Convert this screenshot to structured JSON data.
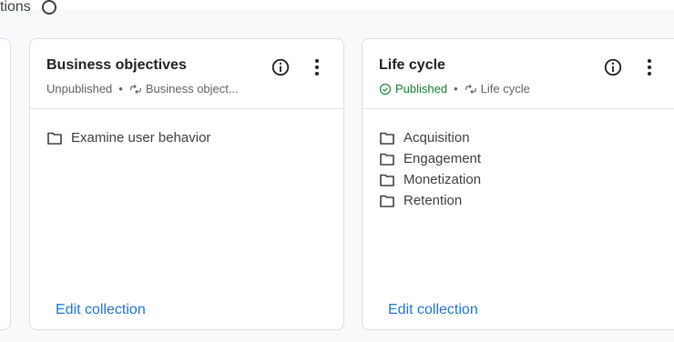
{
  "header_fragment": {
    "text": "tions"
  },
  "cards": [
    {
      "title": "Business objectives",
      "status": "Unpublished",
      "collection": "Business object...",
      "items": [
        "Examine user behavior"
      ],
      "edit_label": "Edit collection"
    },
    {
      "title": "Life cycle",
      "status": "Published",
      "collection": "Life cycle",
      "items": [
        "Acquisition",
        "Engagement",
        "Monetization",
        "Retention"
      ],
      "edit_label": "Edit collection"
    }
  ],
  "icons": {
    "info": "info-icon",
    "more": "more-vert-icon",
    "folder": "folder-icon",
    "collection": "collection-icon",
    "published": "check-circle-icon",
    "help": "help-icon"
  },
  "colors": {
    "link": "#1a73e8",
    "published": "#188038",
    "border": "#dadce0"
  }
}
